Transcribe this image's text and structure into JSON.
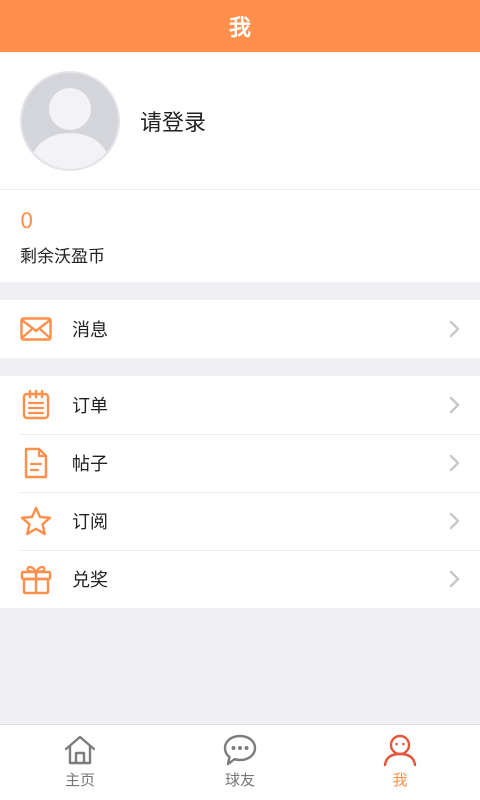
{
  "header": {
    "title": "我"
  },
  "profile": {
    "login_text": "请登录",
    "avatar_icon": "default-avatar-icon"
  },
  "coins": {
    "value": "0",
    "label": "剩余沃盈币"
  },
  "menu_group1": [
    {
      "label": "消息",
      "icon": "envelope-icon"
    }
  ],
  "menu_group2": [
    {
      "label": "订单",
      "icon": "calendar-list-icon"
    },
    {
      "label": "帖子",
      "icon": "document-icon"
    },
    {
      "label": "订阅",
      "icon": "star-icon"
    },
    {
      "label": "兑奖",
      "icon": "gift-icon"
    }
  ],
  "tabs": [
    {
      "label": "主页",
      "icon": "home-icon",
      "active": false
    },
    {
      "label": "球友",
      "icon": "chat-bubble-icon",
      "active": false
    },
    {
      "label": "我",
      "icon": "person-icon",
      "active": true
    }
  ],
  "colors": {
    "accent": "#ff8f4a",
    "icon_gray": "#7d7d7d",
    "chevron": "#c8c8c8",
    "background": "#efeff4"
  }
}
